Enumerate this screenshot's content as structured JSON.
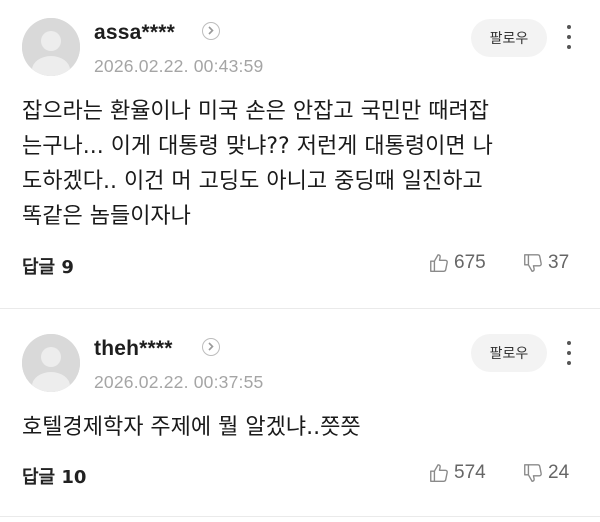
{
  "comments": [
    {
      "username": "assa****",
      "timestamp": "2026.02.22. 00:43:59",
      "follow_label": "팔로우",
      "lines": [
        "잡으라는 환율이나 미국 손은 안잡고 국민만 때려잡",
        "는구나... 이게 대통령 맞냐?? 저런게 대통령이면 나",
        "도하겠다.. 이건 머 고딩도 아니고 중딩때 일진하고",
        "똑같은 놈들이자나"
      ],
      "replies_label": "답글 9",
      "likes": "675",
      "dislikes": "37"
    },
    {
      "username": "theh****",
      "timestamp": "2026.02.22. 00:37:55",
      "follow_label": "팔로우",
      "lines": [
        "호텔경제학자 주제에 뭘 알겠냐..쯧쯧"
      ],
      "replies_label": "답글 10",
      "likes": "574",
      "dislikes": "24"
    }
  ]
}
